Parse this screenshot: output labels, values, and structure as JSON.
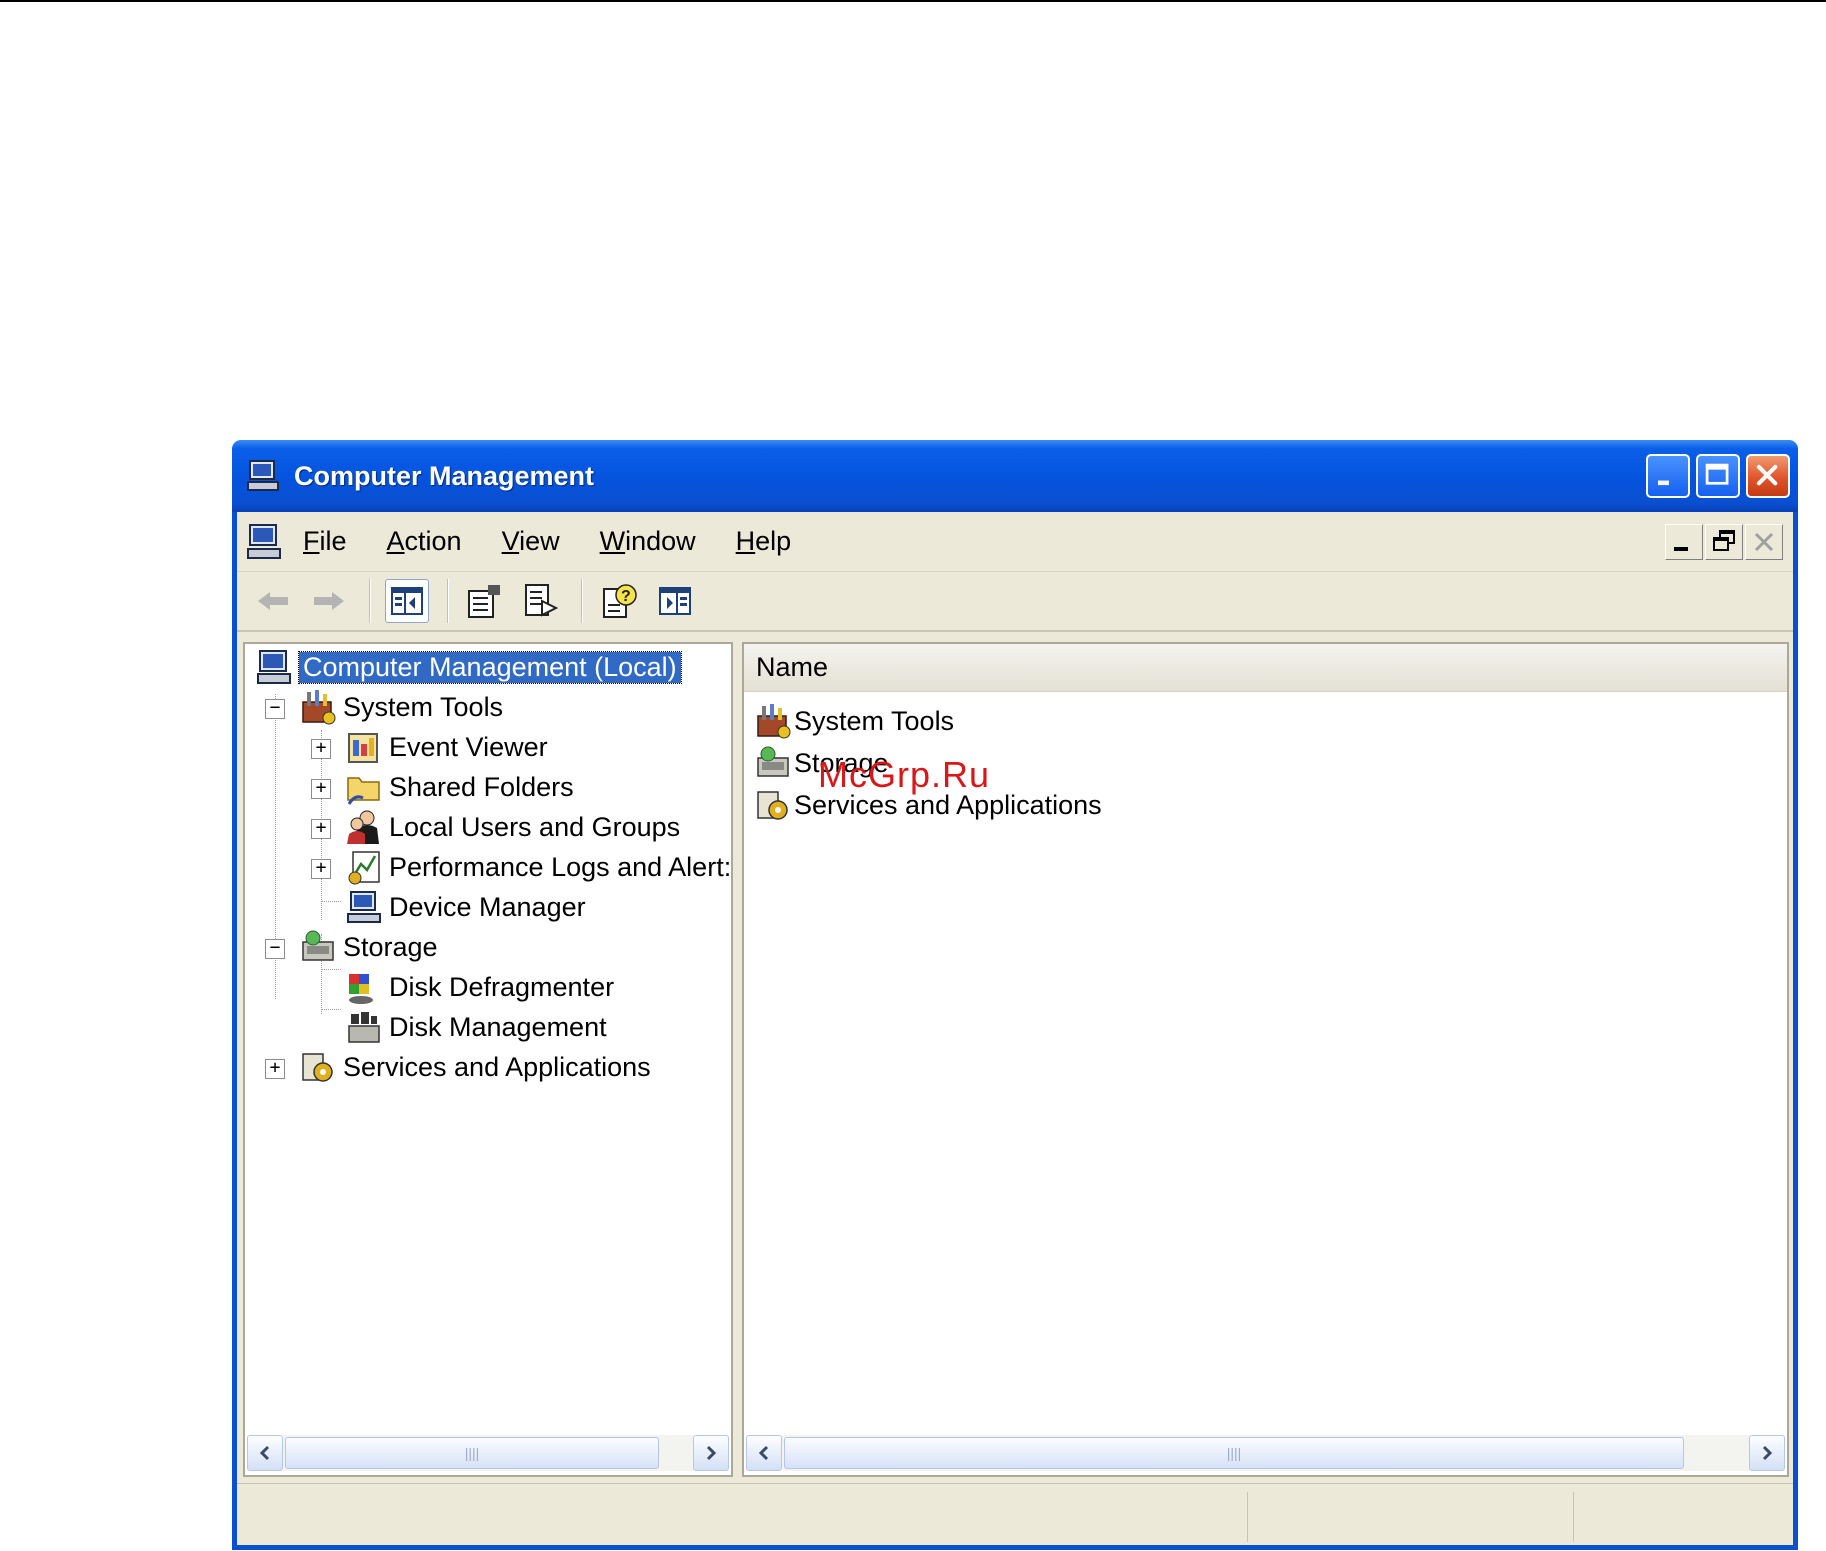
{
  "window": {
    "title": "Computer Management"
  },
  "menubar": {
    "items": [
      {
        "label": "File",
        "mnemonic": "F",
        "rest": "ile"
      },
      {
        "label": "Action",
        "mnemonic": "A",
        "rest": "ction"
      },
      {
        "label": "View",
        "mnemonic": "V",
        "rest": "iew"
      },
      {
        "label": "Window",
        "mnemonic": "W",
        "rest": "indow"
      },
      {
        "label": "Help",
        "mnemonic": "H",
        "rest": "elp"
      }
    ]
  },
  "toolbar": {
    "buttons": [
      "back-arrow-icon",
      "forward-arrow-icon",
      "show-hide-tree-icon",
      "properties-icon",
      "export-list-icon",
      "help-icon",
      "show-hide-action-pane-icon"
    ]
  },
  "tree": {
    "root": "Computer Management (Local)",
    "system_tools": "System Tools",
    "event_viewer": "Event Viewer",
    "shared_folders": "Shared Folders",
    "local_users": "Local Users and Groups",
    "perf_logs": "Performance Logs and Alert:",
    "device_manager": "Device Manager",
    "storage": "Storage",
    "disk_defrag": "Disk Defragmenter",
    "disk_mgmt": "Disk Management",
    "services": "Services and Applications"
  },
  "list": {
    "column_name": "Name",
    "rows": [
      "System Tools",
      "Storage",
      "Services and Applications"
    ]
  },
  "watermark": "McGrp.Ru",
  "colors": {
    "title_blue": "#0454df",
    "selection": "#316ac5",
    "face": "#ece9d8",
    "close_red": "#e0552a"
  }
}
